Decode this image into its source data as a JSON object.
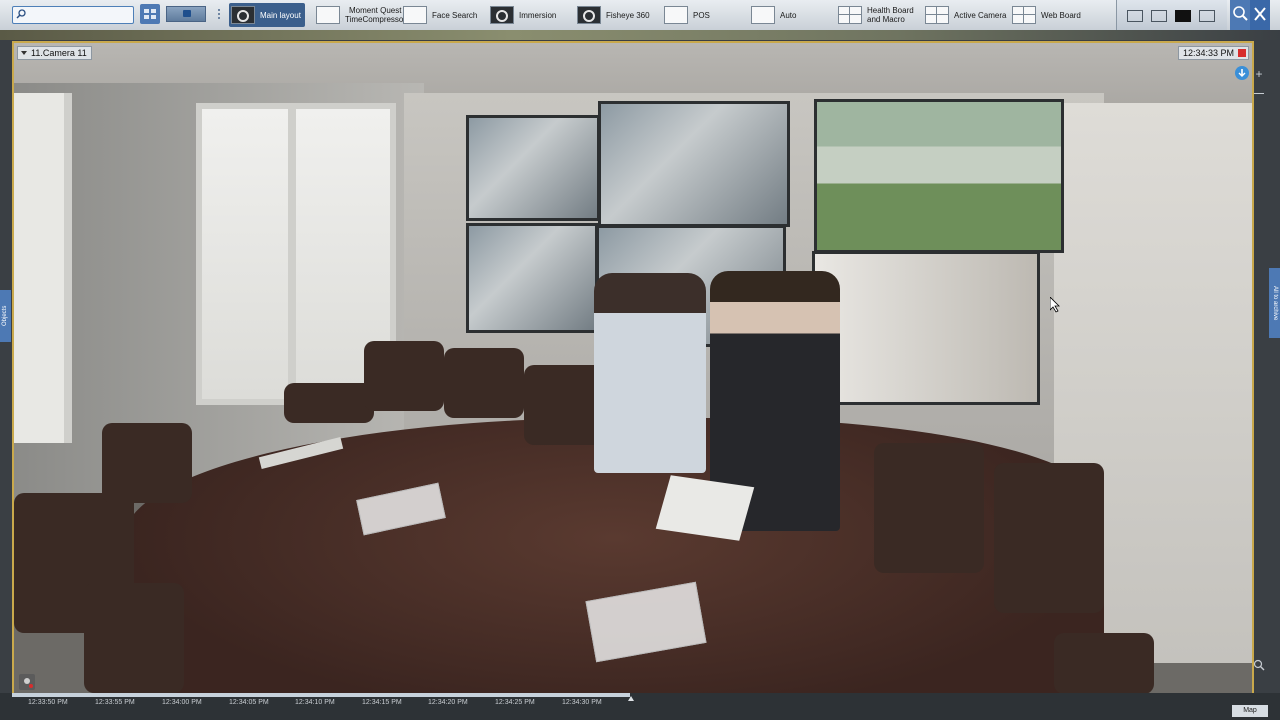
{
  "toolbar": {
    "search": {
      "placeholder": "",
      "value": ""
    },
    "layouts": [
      {
        "label": "Main layout",
        "active": true
      },
      {
        "label": "Moment Quest TimeCompressor",
        "line1": "Moment Quest",
        "line2": "TimeCompressor"
      },
      {
        "label": "Face Search"
      },
      {
        "label": "Immersion"
      },
      {
        "label": "Fisheye 360"
      },
      {
        "label": "POS"
      },
      {
        "label": "Auto"
      },
      {
        "label": "Health Board and Macro",
        "line1": "Health Board",
        "line2": "and Macro"
      },
      {
        "label": "Active Camera"
      },
      {
        "label": "Web Board"
      }
    ],
    "icons": [
      "search-icon",
      "grid-icon",
      "table-icon",
      "hash-grid-icon",
      "black-screen-icon",
      "screen-settings-icon",
      "zoom-search-icon",
      "tools-icon"
    ]
  },
  "camera": {
    "title": "11.Camera 11",
    "time": "12:34:33 PM",
    "status_color": "#d72c2c"
  },
  "side_tabs": {
    "left": "Objects",
    "right": "All to archive"
  },
  "timeline": {
    "labels": [
      "12:33:50 PM",
      "12:33:55 PM",
      "12:34:00 PM",
      "12:34:05 PM",
      "12:34:10 PM",
      "12:34:15 PM",
      "12:34:20 PM",
      "12:34:25 PM",
      "12:34:30 PM"
    ]
  },
  "map_tab": "Map",
  "colors": {
    "accent": "#4d79b4",
    "viewport_border": "#c9a94c",
    "recording": "#d72c2c"
  }
}
